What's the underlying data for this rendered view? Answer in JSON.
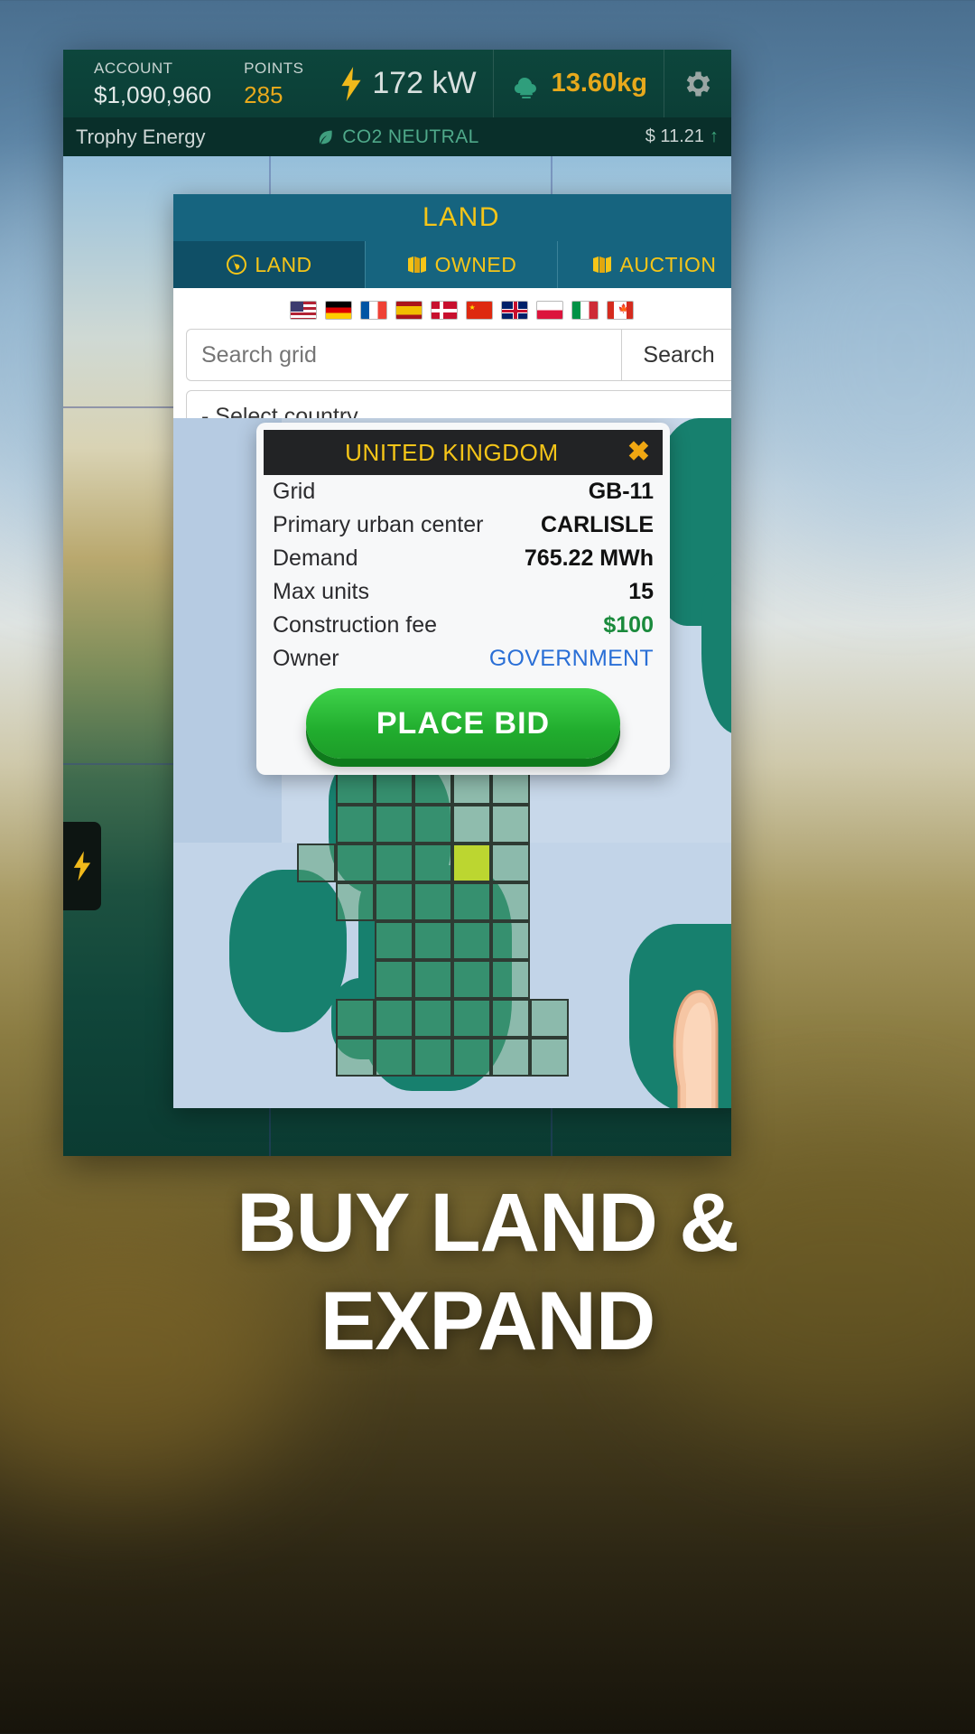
{
  "hud": {
    "account_label": "ACCOUNT",
    "account_value": "$1,090,960",
    "points_label": "POINTS",
    "points_value": "285",
    "power_value": "172 kW",
    "power_icon": "lightning-bolt-icon",
    "co2_value": "13.60kg",
    "co2_icon": "co2-cloud-icon",
    "settings_icon": "gear-icon"
  },
  "subbar": {
    "company": "Trophy Energy",
    "co2_status": "CO2 NEUTRAL",
    "co2_status_icon": "leaf-icon",
    "price": "$ 11.21",
    "price_trend_icon": "arrow-up-icon"
  },
  "panel": {
    "title": "LAND",
    "tabs": [
      {
        "label": "LAND",
        "icon": "globe-icon",
        "active": true
      },
      {
        "label": "OWNED",
        "icon": "map-icon",
        "active": false
      },
      {
        "label": "AUCTION",
        "icon": "map-icon",
        "active": false
      }
    ],
    "flags": [
      {
        "name": "flag-united-states",
        "code": "US"
      },
      {
        "name": "flag-germany",
        "code": "DE"
      },
      {
        "name": "flag-france",
        "code": "FR"
      },
      {
        "name": "flag-spain",
        "code": "ES"
      },
      {
        "name": "flag-denmark",
        "code": "DK"
      },
      {
        "name": "flag-china",
        "code": "CN"
      },
      {
        "name": "flag-united-kingdom",
        "code": "GB"
      },
      {
        "name": "flag-poland",
        "code": "PL"
      },
      {
        "name": "flag-italy",
        "code": "IT"
      },
      {
        "name": "flag-canada",
        "code": "CA"
      }
    ],
    "search": {
      "placeholder": "Search grid",
      "value": "",
      "button_label": "Search"
    },
    "country_select": {
      "selected_label": "- Select country"
    }
  },
  "info_card": {
    "title": "UNITED KINGDOM",
    "close_icon": "close-icon",
    "rows": [
      {
        "label": "Grid",
        "value": "GB-11",
        "style": "plain"
      },
      {
        "label": "Primary urban center",
        "value": "CARLISLE",
        "style": "plain"
      },
      {
        "label": "Demand",
        "value": "765.22 MWh",
        "style": "plain"
      },
      {
        "label": "Max units",
        "value": "15",
        "style": "plain"
      },
      {
        "label": "Construction fee",
        "value": "$100",
        "style": "money"
      },
      {
        "label": "Owner",
        "value": "GOVERNMENT",
        "style": "owner"
      }
    ],
    "bid_button_label": "PLACE BID"
  },
  "rail": {
    "buttons": [
      {
        "name": "rail-building-icon",
        "icon": "rounded-square-icon"
      },
      {
        "name": "rail-wind-turbine-icon",
        "icon": "turbine-icon"
      },
      {
        "name": "rail-power-icon",
        "icon": "lightning-bolt-icon"
      },
      {
        "name": "rail-battery-icon",
        "icon": "battery-icon"
      }
    ],
    "left_flap_icon": "lightning-bolt-icon"
  },
  "caption": {
    "line1": "BUY LAND &",
    "line2": "EXPAND"
  },
  "colors": {
    "hud_bg": "#0b3e36",
    "panel_header": "#16647f",
    "accent_yellow": "#f5c518",
    "bid_green": "#21ad2e",
    "selected_cell": "#bcd630",
    "land_green": "#17806e",
    "owner_blue": "#2a6fd6",
    "money_green": "#1a8a3c"
  }
}
